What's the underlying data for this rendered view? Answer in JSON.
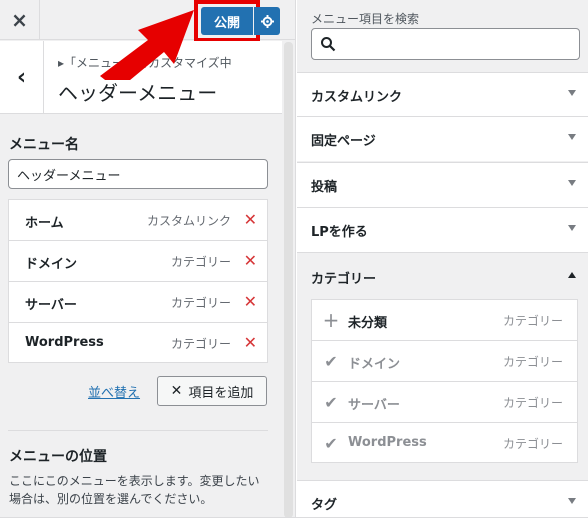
{
  "topbar": {
    "close_label": "×",
    "publish_label": "公開",
    "settings_icon": "gear-icon"
  },
  "section_header": {
    "back_label": "‹",
    "breadcrumb": "▸「メニュー」をカスタマイズ中",
    "title": "ヘッダーメニュー"
  },
  "menu_name": {
    "label": "メニュー名",
    "value": "ヘッダーメニュー"
  },
  "menu_items": [
    {
      "title": "ホーム",
      "type": "カスタムリンク"
    },
    {
      "title": "ドメイン",
      "type": "カテゴリー"
    },
    {
      "title": "サーバー",
      "type": "カテゴリー"
    },
    {
      "title": "WordPress",
      "type": "カテゴリー"
    }
  ],
  "actions": {
    "reorder_label": "並べ替え",
    "add_items_label": "項目を追加"
  },
  "menu_location": {
    "title": "メニューの位置",
    "description": "ここにこのメニューを表示します。変更したい場合は、別の位置を選んでください。"
  },
  "search": {
    "label": "メニュー項目を検索",
    "placeholder": ""
  },
  "accordion": [
    {
      "title": "カスタムリンク"
    },
    {
      "title": "固定ページ"
    },
    {
      "title": "投稿"
    },
    {
      "title": "LPを作る"
    }
  ],
  "categories": {
    "title": "カテゴリー",
    "items": [
      {
        "title": "未分類",
        "type": "カテゴリー",
        "added": false
      },
      {
        "title": "ドメイン",
        "type": "カテゴリー",
        "added": true
      },
      {
        "title": "サーバー",
        "type": "カテゴリー",
        "added": true
      },
      {
        "title": "WordPress",
        "type": "カテゴリー",
        "added": true
      }
    ]
  },
  "tags": {
    "title": "タグ"
  },
  "colors": {
    "accent": "#2271b1",
    "delete": "#d63638",
    "highlight": "#e60000"
  }
}
